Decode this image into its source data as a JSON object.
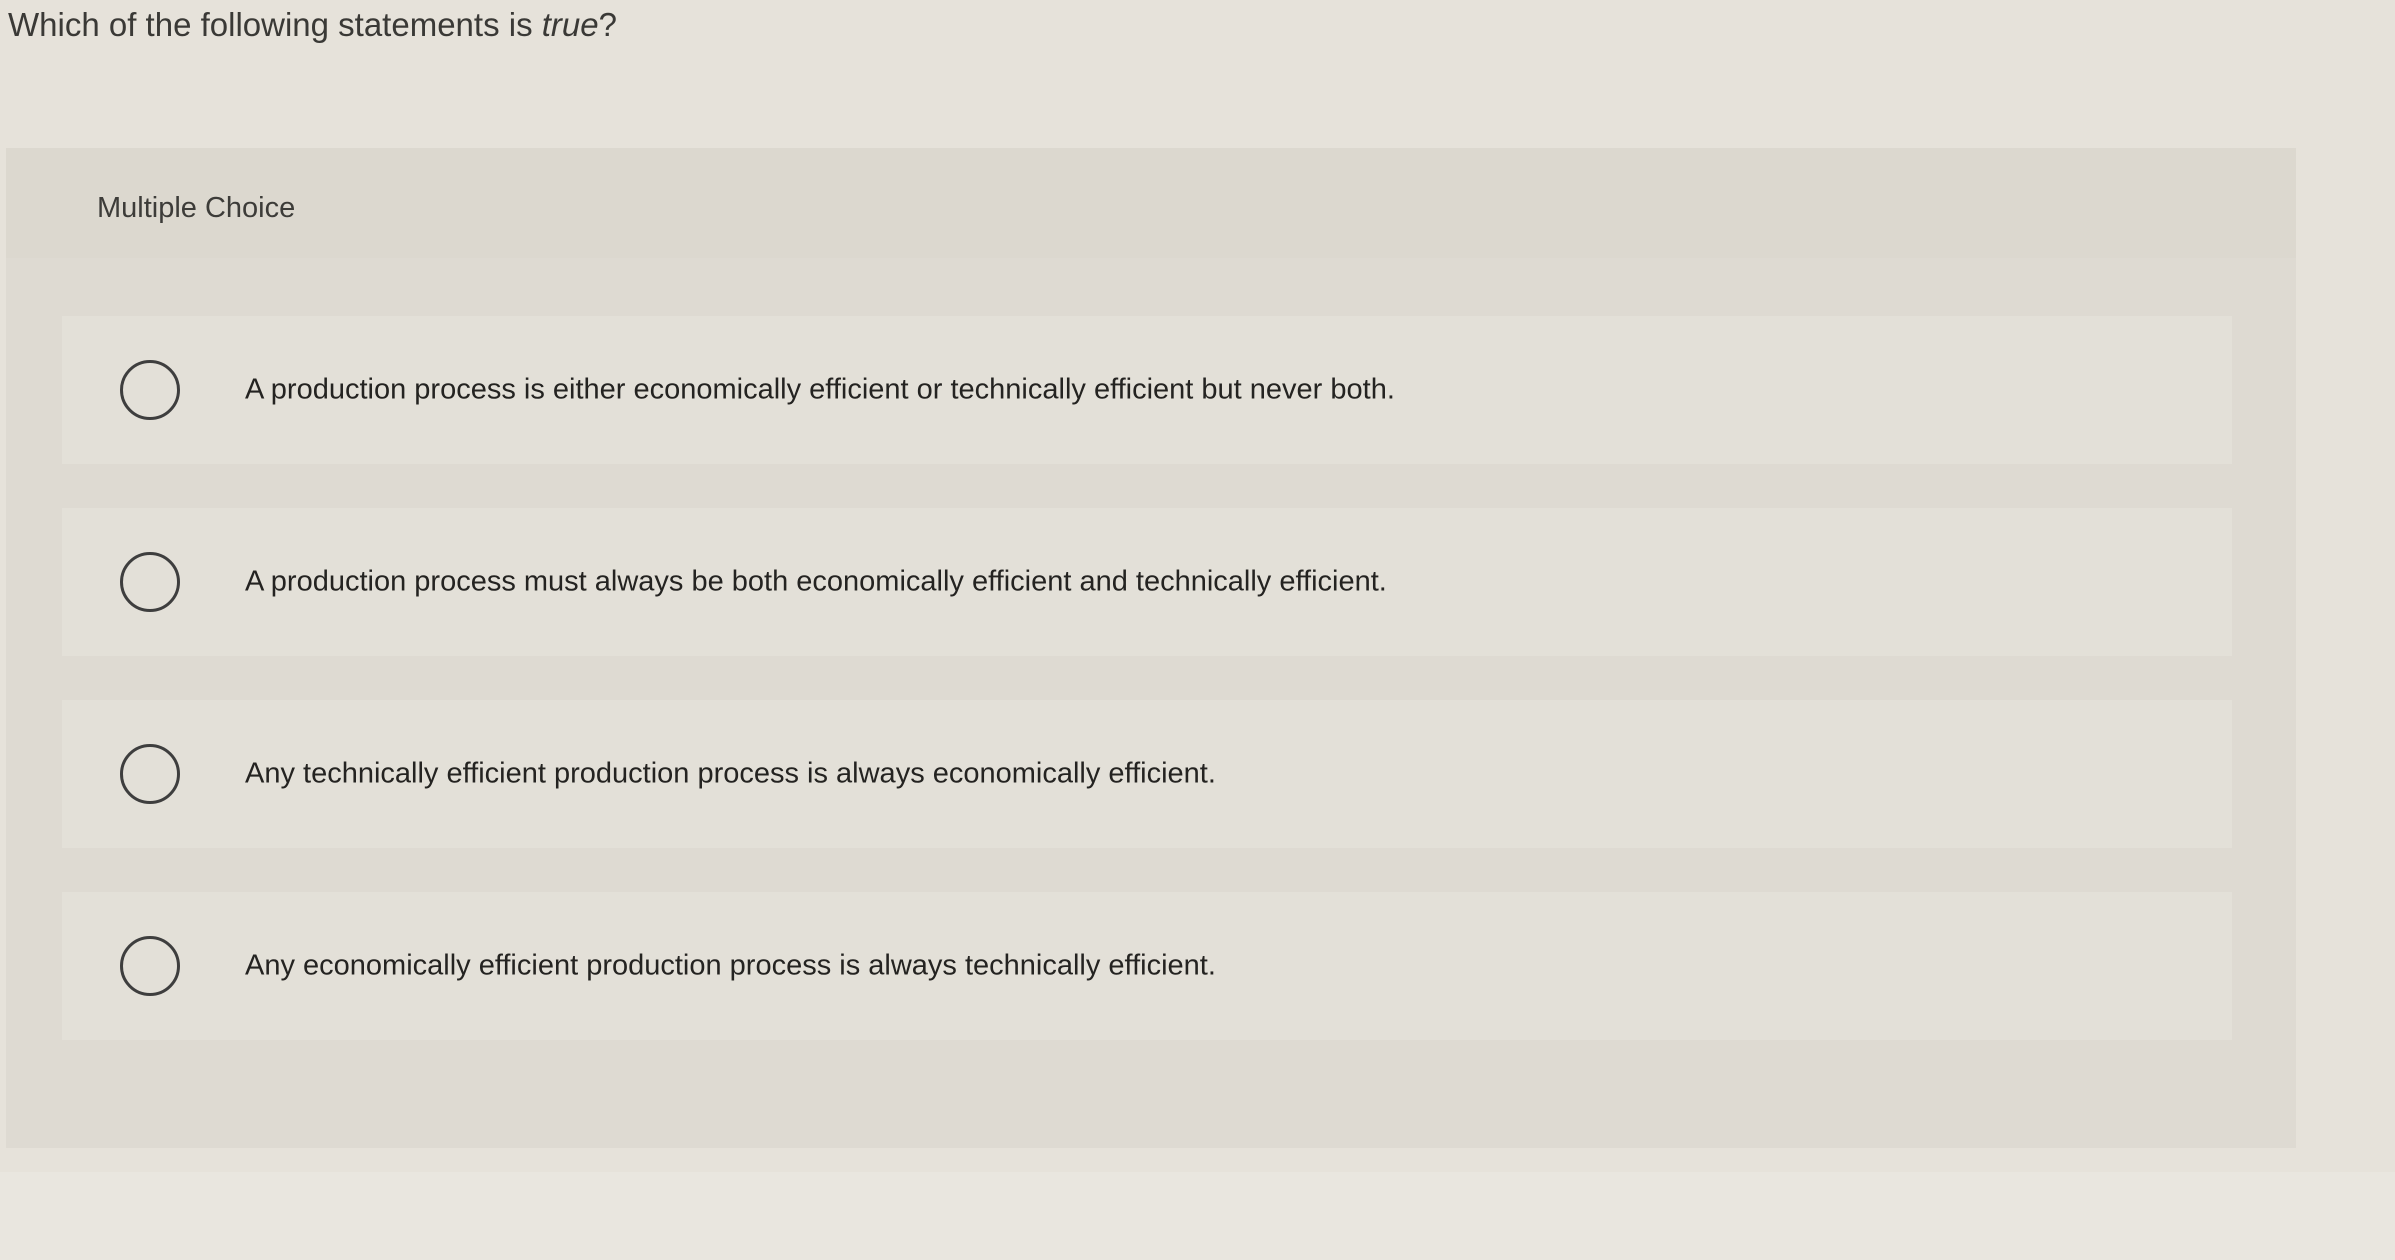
{
  "question": {
    "prefix": "Which of the following statements is ",
    "emphasis": "true",
    "suffix": "?"
  },
  "panel": {
    "header_label": "Multiple Choice"
  },
  "choices": [
    {
      "label": "A production process is either economically efficient or technically efficient but never both.",
      "selected": false
    },
    {
      "label": "A production process must always be both economically efficient and technically efficient.",
      "selected": false
    },
    {
      "label": "Any technically efficient production process is always economically efficient.",
      "selected": false
    },
    {
      "label": "Any economically efficient production process is always technically efficient.",
      "selected": false
    }
  ]
}
